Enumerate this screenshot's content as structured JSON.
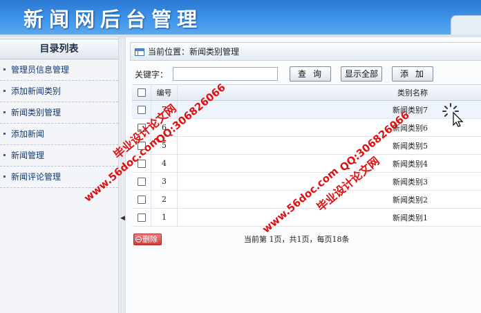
{
  "header": {
    "title": "新闻网后台管理"
  },
  "sidebar": {
    "title": "目录列表",
    "items": [
      {
        "label": "管理员信息管理"
      },
      {
        "label": "添加新闻类别"
      },
      {
        "label": "新闻类别管理"
      },
      {
        "label": "添加新闻"
      },
      {
        "label": "新闻管理"
      },
      {
        "label": "新闻评论管理"
      }
    ]
  },
  "breadcrumb": {
    "text": "当前位置：新闻类别管理"
  },
  "search": {
    "label": "关键字：",
    "value": "",
    "search_button": "查询",
    "show_all_button": "显示全部",
    "add_button": "添加"
  },
  "table": {
    "columns": {
      "id": "编号",
      "name": "类别名称"
    },
    "rows": [
      {
        "id": "7",
        "name": "新闻类别7"
      },
      {
        "id": "6",
        "name": "新闻类别6"
      },
      {
        "id": "5",
        "name": "新闻类别5"
      },
      {
        "id": "4",
        "name": "新闻类别4"
      },
      {
        "id": "3",
        "name": "新闻类别3"
      },
      {
        "id": "2",
        "name": "新闻类别2"
      },
      {
        "id": "1",
        "name": "新闻类别1"
      }
    ]
  },
  "actions": {
    "delete_button": "删除"
  },
  "pagination": {
    "text": "当前第 1页，共1页，每页18条"
  },
  "watermarks": {
    "site": "www.56doc.com",
    "qq": "QQ:306826066",
    "name": "毕业设计论文网"
  }
}
